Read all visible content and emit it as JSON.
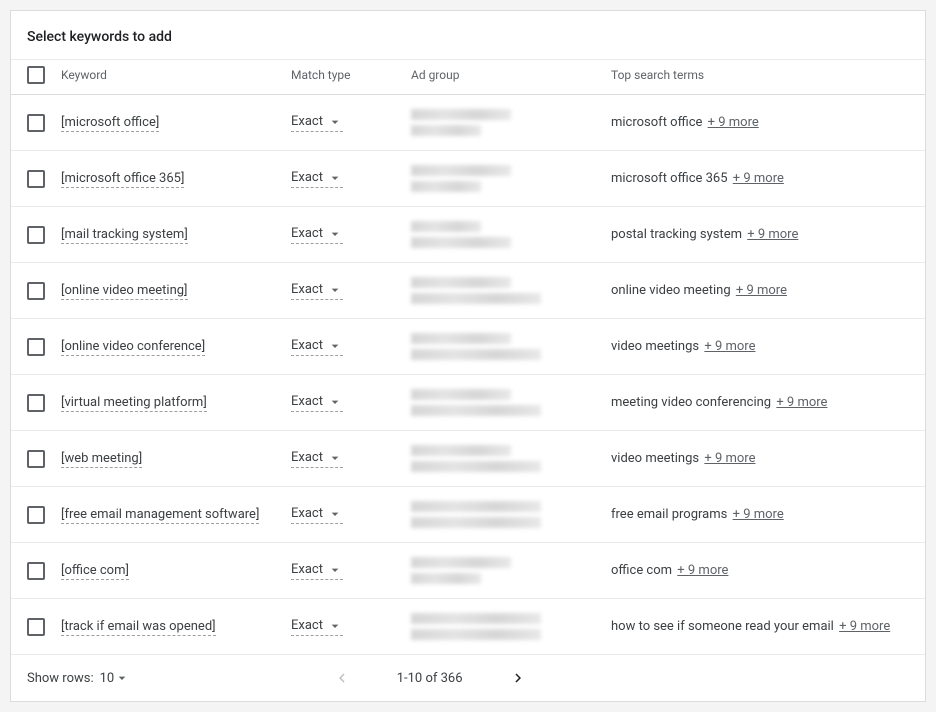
{
  "header": {
    "title": "Select keywords to add"
  },
  "columns": {
    "keyword": "Keyword",
    "match_type": "Match type",
    "ad_group": "Ad group",
    "top_search_terms": "Top search terms"
  },
  "rows": [
    {
      "keyword": "[microsoft office]",
      "match_type": "Exact",
      "top_term": "microsoft office",
      "more": "+ 9 more"
    },
    {
      "keyword": "[microsoft office 365]",
      "match_type": "Exact",
      "top_term": "microsoft office 365",
      "more": "+ 9 more"
    },
    {
      "keyword": "[mail tracking system]",
      "match_type": "Exact",
      "top_term": "postal tracking system",
      "more": "+ 9 more"
    },
    {
      "keyword": "[online video meeting]",
      "match_type": "Exact",
      "top_term": "online video meeting",
      "more": "+ 9 more"
    },
    {
      "keyword": "[online video conference]",
      "match_type": "Exact",
      "top_term": "video meetings",
      "more": "+ 9 more"
    },
    {
      "keyword": "[virtual meeting platform]",
      "match_type": "Exact",
      "top_term": "meeting video conferencing",
      "more": "+ 9 more"
    },
    {
      "keyword": "[web meeting]",
      "match_type": "Exact",
      "top_term": "video meetings",
      "more": "+ 9 more"
    },
    {
      "keyword": "[free email management software]",
      "match_type": "Exact",
      "top_term": "free email programs",
      "more": "+ 9 more"
    },
    {
      "keyword": "[office com]",
      "match_type": "Exact",
      "top_term": "office com",
      "more": "+ 9 more"
    },
    {
      "keyword": "[track if email was opened]",
      "match_type": "Exact",
      "top_term": "how to see if someone read your email",
      "more": "+ 9 more"
    }
  ],
  "footer": {
    "show_rows_label": "Show rows:",
    "rows_per_page": "10",
    "page_range": "1-10 of 366"
  }
}
